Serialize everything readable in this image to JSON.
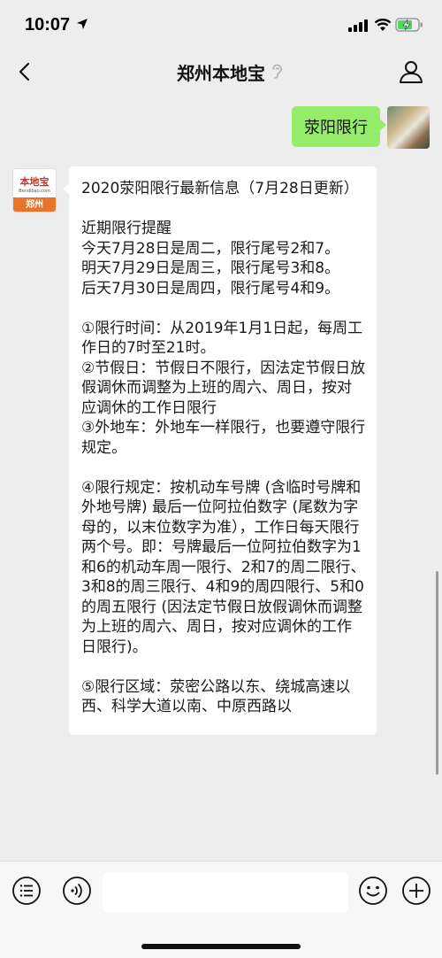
{
  "status": {
    "time": "10:07",
    "icons": [
      "location-arrow-icon",
      "signal-icon",
      "wifi-icon",
      "battery-charging-icon"
    ]
  },
  "nav": {
    "title": "郑州本地宝",
    "icons": [
      "back-chevron-icon",
      "ear-icon",
      "profile-icon"
    ]
  },
  "chat": {
    "user_message": "荥阳限行",
    "bot_avatar": {
      "logo_text": "本地宝",
      "logo_url": "Bendibao.com",
      "city": "郑州"
    },
    "bot_message": "2020荥阳限行最新信息（7月28日更新）\n\n近期限行提醒\n今天7月28日是周二，限行尾号2和7。\n明天7月29日是周三，限行尾号3和8。\n后天7月30日是周四，限行尾号4和9。\n\n①限行时间：从2019年1月1日起，每周工作日的7时至21时。\n②节假日：节假日不限行，因法定节假日放假调休而调整为上班的周六、周日，按对应调休的工作日限行\n③外地车：外地车一样限行，也要遵守限行规定。\n\n④限行规定：按机动车号牌 (含临时号牌和外地号牌) 最后一位阿拉伯数字 (尾数为字母的，以末位数字为准），工作日每天限行两个号。即：号牌最后一位阿拉伯数字为1和6的机动车周一限行、2和7的周二限行、3和8的周三限行、4和9的周四限行、5和0的周五限行 (因法定节假日放假调休而调整为上班的周六、周日，按对应调休的工作日限行)。\n\n⑤限行区域：荥密公路以东、绕城高速以西、科学大道以南、中原西路以"
  },
  "input_bar": {
    "value": "",
    "icons": [
      "menu-list-icon",
      "voice-icon",
      "emoji-icon",
      "plus-icon"
    ]
  },
  "colors": {
    "background": "#ededed",
    "user_bubble": "#95ec69",
    "bot_bubble": "#ffffff",
    "avatar_accent": "#e8742b"
  }
}
